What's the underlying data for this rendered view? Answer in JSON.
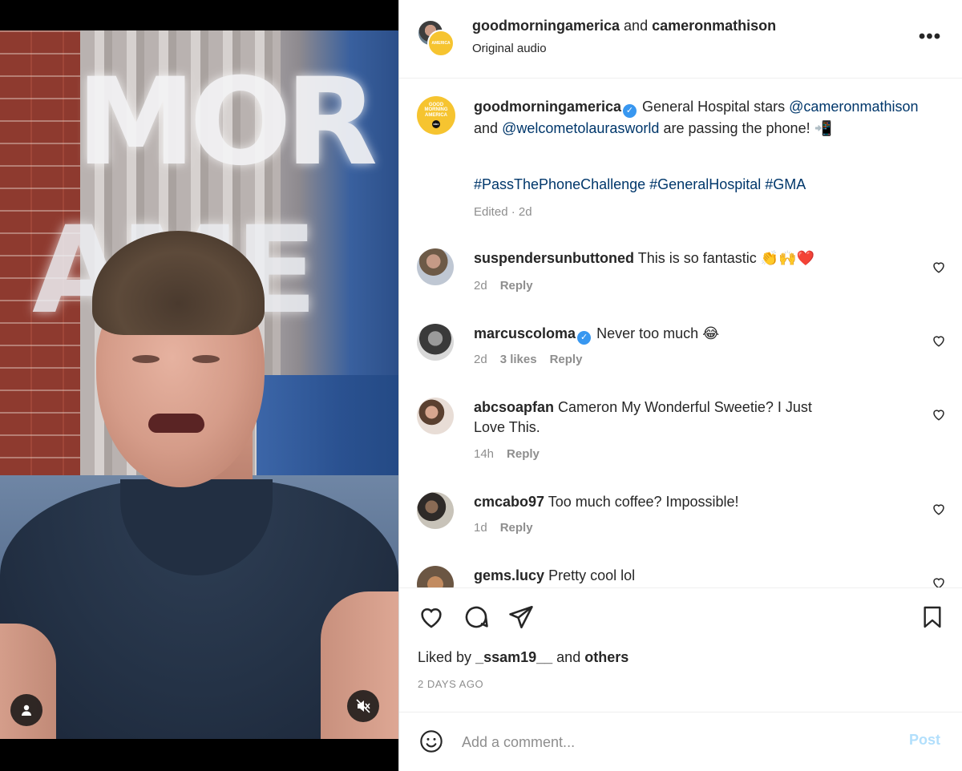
{
  "header": {
    "user1": "goodmorningamerica",
    "and_word": "and",
    "user2": "cameronmathison",
    "audio": "Original audio"
  },
  "avatar_gma": {
    "line1": "GOOD",
    "line2": "MORNING",
    "line3": "AMERICA"
  },
  "caption": {
    "username": "goodmorningamerica",
    "text_part1": "General Hospital stars",
    "mention1": "@cameronmathison",
    "text_and": "and",
    "mention2": "@welcometolaurasworld",
    "text_part2": "are passing the phone! 📲",
    "hashtags": "#PassThePhoneChallenge #GeneralHospital #GMA",
    "meta": "Edited · 2d"
  },
  "comments": [
    {
      "username": "suspendersunbuttoned",
      "text": "This is so fantastic 👏🙌❤️",
      "verified": false,
      "age": "2d",
      "likes": "",
      "reply": "Reply"
    },
    {
      "username": "marcuscoloma",
      "text": "Never too much 😂",
      "verified": true,
      "age": "2d",
      "likes": "3 likes",
      "reply": "Reply"
    },
    {
      "username": "abcsoapfan",
      "text": "Cameron My Wonderful Sweetie? I Just Love This.",
      "verified": false,
      "age": "14h",
      "likes": "",
      "reply": "Reply"
    },
    {
      "username": "cmcabo97",
      "text": "Too much coffee? Impossible!",
      "verified": false,
      "age": "1d",
      "likes": "",
      "reply": "Reply"
    },
    {
      "username": "gems.lucy",
      "text": "Pretty cool lol",
      "verified": false,
      "age": "",
      "likes": "",
      "reply": ""
    }
  ],
  "likes": {
    "prefix": "Liked by",
    "user": "_ssam19__",
    "and_word": "and",
    "others": "others"
  },
  "timestamp": "2 DAYS AGO",
  "add_comment": {
    "placeholder": "Add a comment...",
    "post_label": "Post"
  },
  "colors": {
    "link": "#00376b",
    "verified": "#3897f0",
    "muted": "#8e8e8e",
    "post_disabled": "#b2dffc",
    "gma_yellow": "#f6c430"
  },
  "icons": [
    "person-tag-icon",
    "muted-speaker-icon",
    "more-options-icon",
    "heart-icon",
    "comment-icon",
    "share-icon",
    "bookmark-icon",
    "emoji-icon"
  ]
}
